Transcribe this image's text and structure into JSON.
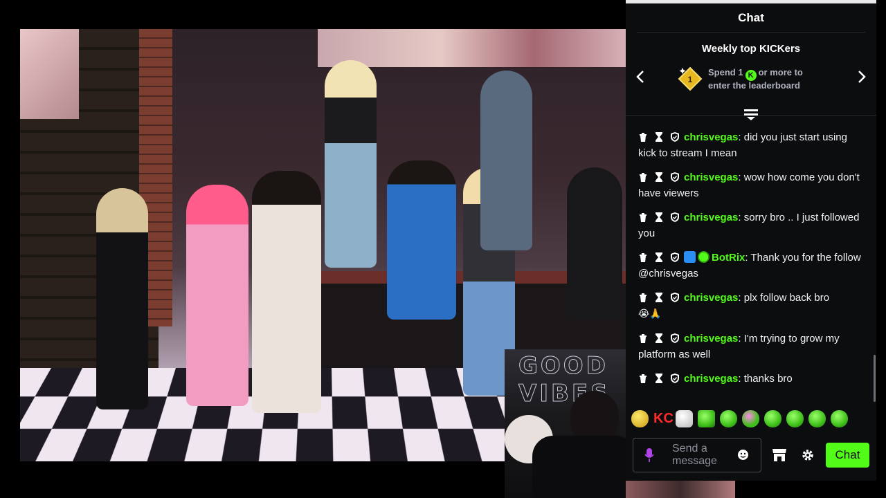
{
  "chat": {
    "title": "Chat",
    "leaderboard": {
      "title": "Weekly top KICKers",
      "badge_number": "1",
      "spend_prefix": "Spend 1",
      "spend_suffix": "or more to",
      "spend_line2": "enter the leaderboard"
    },
    "messages": [
      {
        "user": "chrisvegas",
        "text": ": did you just start using kick to stream I mean"
      },
      {
        "user": "chrisvegas",
        "text": ": wow how come you don't have viewers"
      },
      {
        "user": "chrisvegas",
        "text": ": sorry bro .. I just followed you"
      },
      {
        "user": "BotRix",
        "text": ": Thank you for the follow @chrisvegas",
        "badges": [
          "hammer-badge",
          "verified-badge"
        ]
      },
      {
        "user": "chrisvegas",
        "text": ": plx follow back bro",
        "emojis": "😭🙏"
      },
      {
        "user": "chrisvegas",
        "text": ": I'm trying to grow my platform as well"
      },
      {
        "user": "chrisvegas",
        "text": ": thanks bro"
      }
    ],
    "input": {
      "placeholder_line1": "Send a",
      "placeholder_line2": "message"
    },
    "send_button": "Chat",
    "emote_kc": "KC"
  },
  "colors": {
    "accent": "#53fc18",
    "background": "#0c0d0f",
    "text_muted": "#aeb2bd"
  },
  "icons": [
    "chevron-left-icon",
    "chevron-right-icon",
    "collapse-icon",
    "trash-icon",
    "timeout-icon",
    "shield-icon",
    "mic-icon",
    "smiley-icon",
    "store-icon",
    "gear-icon"
  ]
}
